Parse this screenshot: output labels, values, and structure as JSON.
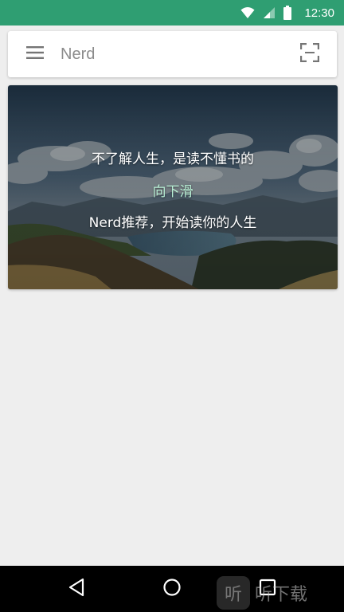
{
  "status_bar": {
    "time": "12:30",
    "icons": [
      "wifi-icon",
      "signal-icon",
      "battery-icon"
    ],
    "background": "#2f9e72"
  },
  "header": {
    "title": "Nerd",
    "menu_icon": "hamburger-menu-icon",
    "scan_icon": "scan-frame-icon"
  },
  "hero": {
    "line1": "不了解人生，是读不懂书的",
    "line2": "向下滑",
    "line3": "Nerd推荐，开始读你的人生",
    "accent_color": "#b9f0d6"
  },
  "nav_bar": {
    "icons": [
      "back-icon",
      "home-icon",
      "recent-apps-icon"
    ]
  },
  "watermark": {
    "badge": "听",
    "text": "听下载"
  }
}
